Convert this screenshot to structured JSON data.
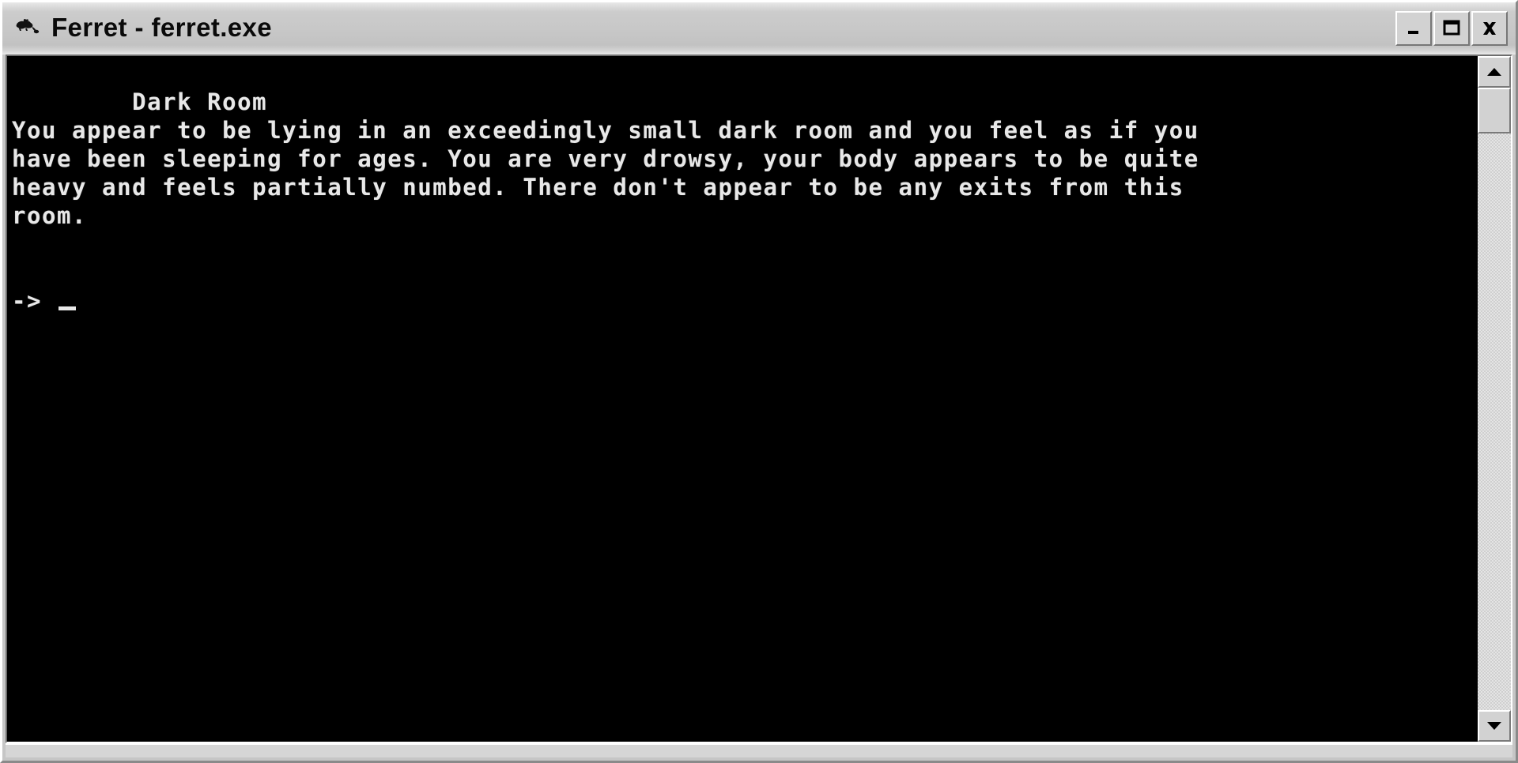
{
  "window": {
    "title": "Ferret - ferret.exe",
    "app_icon": "ferret-icon",
    "colors": {
      "titlebar": "#c8c8c8",
      "frame": "#c6c6c6",
      "terminal_background": "#000000",
      "terminal_text": "#e8e8e8"
    }
  },
  "window_buttons": {
    "minimize_label": "_",
    "maximize_label": "□",
    "close_label": "✕"
  },
  "terminal": {
    "room_title": "Dark Room",
    "lines": [
      "Dark Room",
      "You appear to be lying in an exceedingly small dark room and you feel as if you",
      "have been sleeping for ages. You are very drowsy, your body appears to be quite",
      "heavy and feels partially numbed. There don't appear to be any exits from this",
      "room."
    ],
    "body_text": "Dark Room\nYou appear to be lying in an exceedingly small dark room and you feel as if you\nhave been sleeping for ages. You are very drowsy, your body appears to be quite\nheavy and feels partially numbed. There don't appear to be any exits from this\nroom.",
    "prompt_symbol": "-> ",
    "input_value": "",
    "cursor_visible": true
  },
  "scrollbar": {
    "up_arrow": "▲",
    "down_arrow": "▼",
    "thumb_position_percent": 0,
    "thumb_size_percent": 8
  }
}
